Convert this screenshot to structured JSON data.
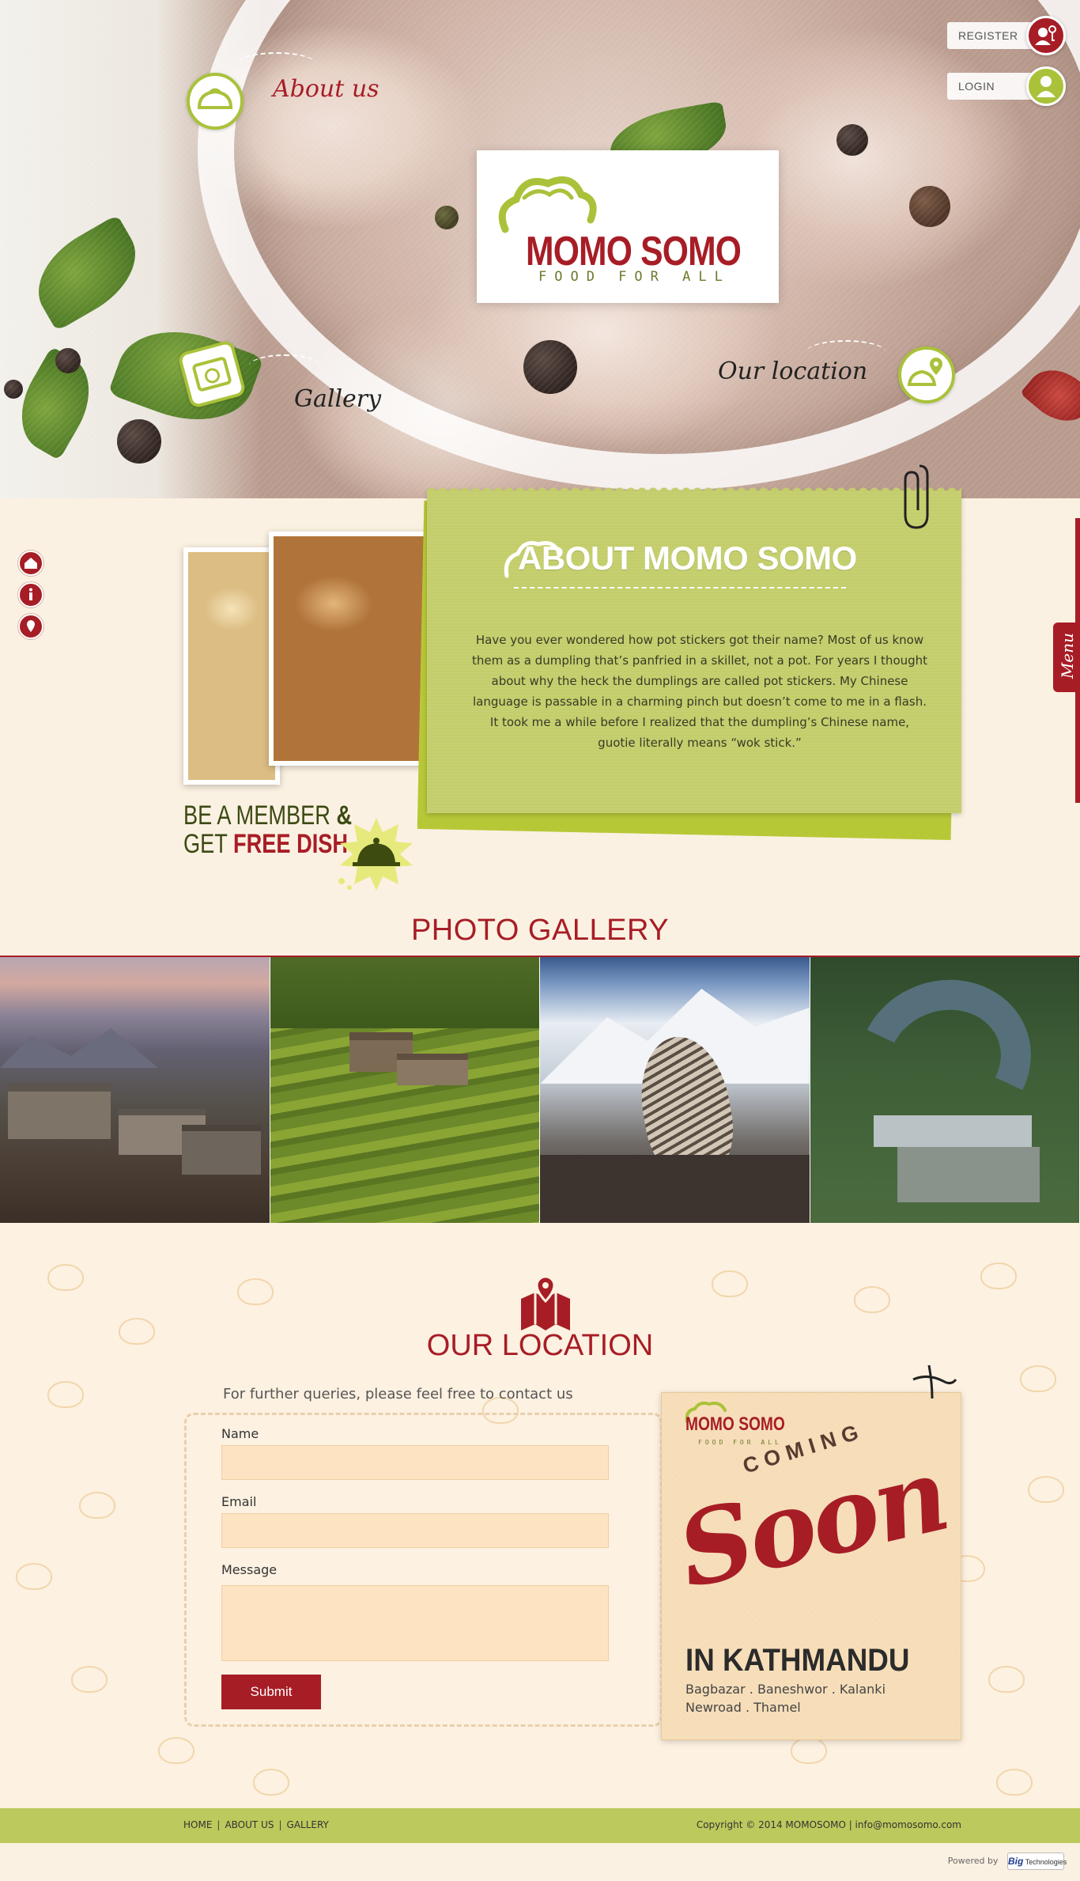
{
  "colors": {
    "brand_red": "#a71d26",
    "brand_green": "#a9c23a",
    "cream": "#fbf1e2",
    "footer_green": "#bcc95c"
  },
  "auth": {
    "register_label": "REGISTER",
    "register_icon": "key-user-icon",
    "login_label": "LOGIN",
    "login_icon": "user-icon"
  },
  "hero": {
    "logo_title": "MOMO SOMO",
    "logo_tagline": "FOOD FOR ALL",
    "about_link": "About us",
    "gallery_link": "Gallery",
    "location_link": "Our location"
  },
  "side_nav": [
    {
      "icon": "home-icon"
    },
    {
      "icon": "info-icon"
    },
    {
      "icon": "location-pin-icon"
    }
  ],
  "menu_tab": "Menu",
  "about": {
    "title": "ABOUT MOMO SOMO",
    "text": "Have you ever wondered how pot stickers got their name? Most of us know them as a dumpling that’s panfried in a skillet, not a pot. For years I thought about why the heck the dumplings are called pot stickers. My Chinese language is passable in a charming pinch but doesn’t come to me in a flash. It took me a while before I realized that  the dumpling’s Chinese name, guotie literally means “wok  stick.”"
  },
  "promo": {
    "line1_a": "BE A MEMBER ",
    "line1_amp": "&",
    "line2_a": "GET ",
    "line2_b": "FREE DISH"
  },
  "gallery": {
    "title": "PHOTO GALLERY",
    "items": [
      {
        "name": "mountain-village"
      },
      {
        "name": "rice-terraces"
      },
      {
        "name": "bird-on-rock"
      },
      {
        "name": "river-dam"
      }
    ]
  },
  "location": {
    "title": "OUR LOCATION",
    "subtitle": "For further queries, please feel free to contact us",
    "name_label": "Name",
    "name_value": "",
    "email_label": "Email",
    "email_value": "",
    "message_label": "Message",
    "message_value": "",
    "submit_label": "Submit"
  },
  "coming_soon": {
    "logo": "MOMO SOMO",
    "logo_tagline": "FOOD FOR ALL",
    "coming": "COMING",
    "soon": "Soon",
    "city": "IN KATHMANDU",
    "areas_line1": "Bagbazar . Baneshwor . Kalanki",
    "areas_line2": "Newroad . Thamel"
  },
  "footer": {
    "nav": [
      "HOME",
      "ABOUT US",
      "GALLERY"
    ],
    "copyright": "Copyright © 2014 MOMOSOMO | info@momosomo.com",
    "powered_by": "Powered by",
    "powered_logo": "Big",
    "powered_logo_sub": "Technologies"
  }
}
